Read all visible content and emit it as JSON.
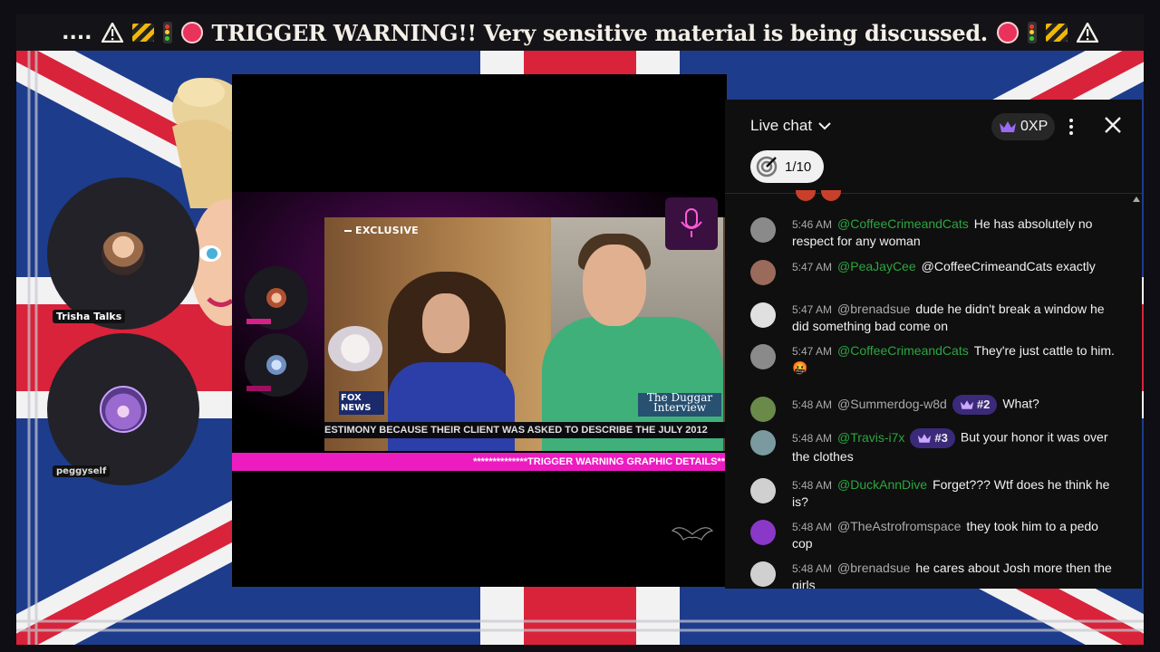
{
  "ticker": {
    "prefix": "....",
    "text": "TRIGGER WARNING!! Very sensitive material is being discussed."
  },
  "guests": [
    {
      "name": "Trisha Talks"
    },
    {
      "name": "peggyself"
    }
  ],
  "video": {
    "badge": "EXCLUSIVE",
    "network_line1": "FOX",
    "network_line2": "NEWS",
    "show_title_line1": "The Duggar",
    "show_title_line2": "Interview",
    "lower_third": "ESTIMONY BECAUSE THEIR CLIENT WAS ASKED TO DESCRIBE THE JULY 2012",
    "pink_bar": "**************TRIGGER WARNING GRAPHIC DETAILS**"
  },
  "chat": {
    "title": "Live chat",
    "xp_label": "0XP",
    "goal_progress": "1/10",
    "messages": [
      {
        "time": "5:46 AM",
        "author": "@CoffeeCrimeandCats",
        "member": true,
        "text": "He has absolutely no respect for any woman",
        "rank": ""
      },
      {
        "time": "5:47 AM",
        "author": "@PeaJayCee",
        "member": true,
        "text": "@CoffeeCrimeandCats exactly",
        "rank": ""
      },
      {
        "time": "5:47 AM",
        "author": "@brenadsue",
        "member": false,
        "text": "dude he didn't break a window he did something bad come on",
        "rank": ""
      },
      {
        "time": "5:47 AM",
        "author": "@CoffeeCrimeandCats",
        "member": true,
        "text": "They're just cattle to him. 🤬",
        "rank": ""
      },
      {
        "time": "5:48 AM",
        "author": "@Summerdog-w8d",
        "member": false,
        "text": "What?",
        "rank": "#2"
      },
      {
        "time": "5:48 AM",
        "author": "@Travis-i7x",
        "member": true,
        "text": "But your honor it was over the clothes",
        "rank": "#3"
      },
      {
        "time": "5:48 AM",
        "author": "@DuckAnnDive",
        "member": true,
        "text": "Forget??? Wtf does he think he is?",
        "rank": ""
      },
      {
        "time": "5:48 AM",
        "author": "@TheAstrofromspace",
        "member": false,
        "text": "they took him to a pedo cop",
        "rank": ""
      },
      {
        "time": "5:48 AM",
        "author": "@brenadsue",
        "member": false,
        "text": "he cares about Josh more then the girls",
        "rank": ""
      }
    ]
  },
  "colors": {
    "pink_accent": "#ec1cc0",
    "chat_bg": "#0f0f0f",
    "member_green": "#2ba640",
    "rank_purple": "#3b2a7a"
  }
}
